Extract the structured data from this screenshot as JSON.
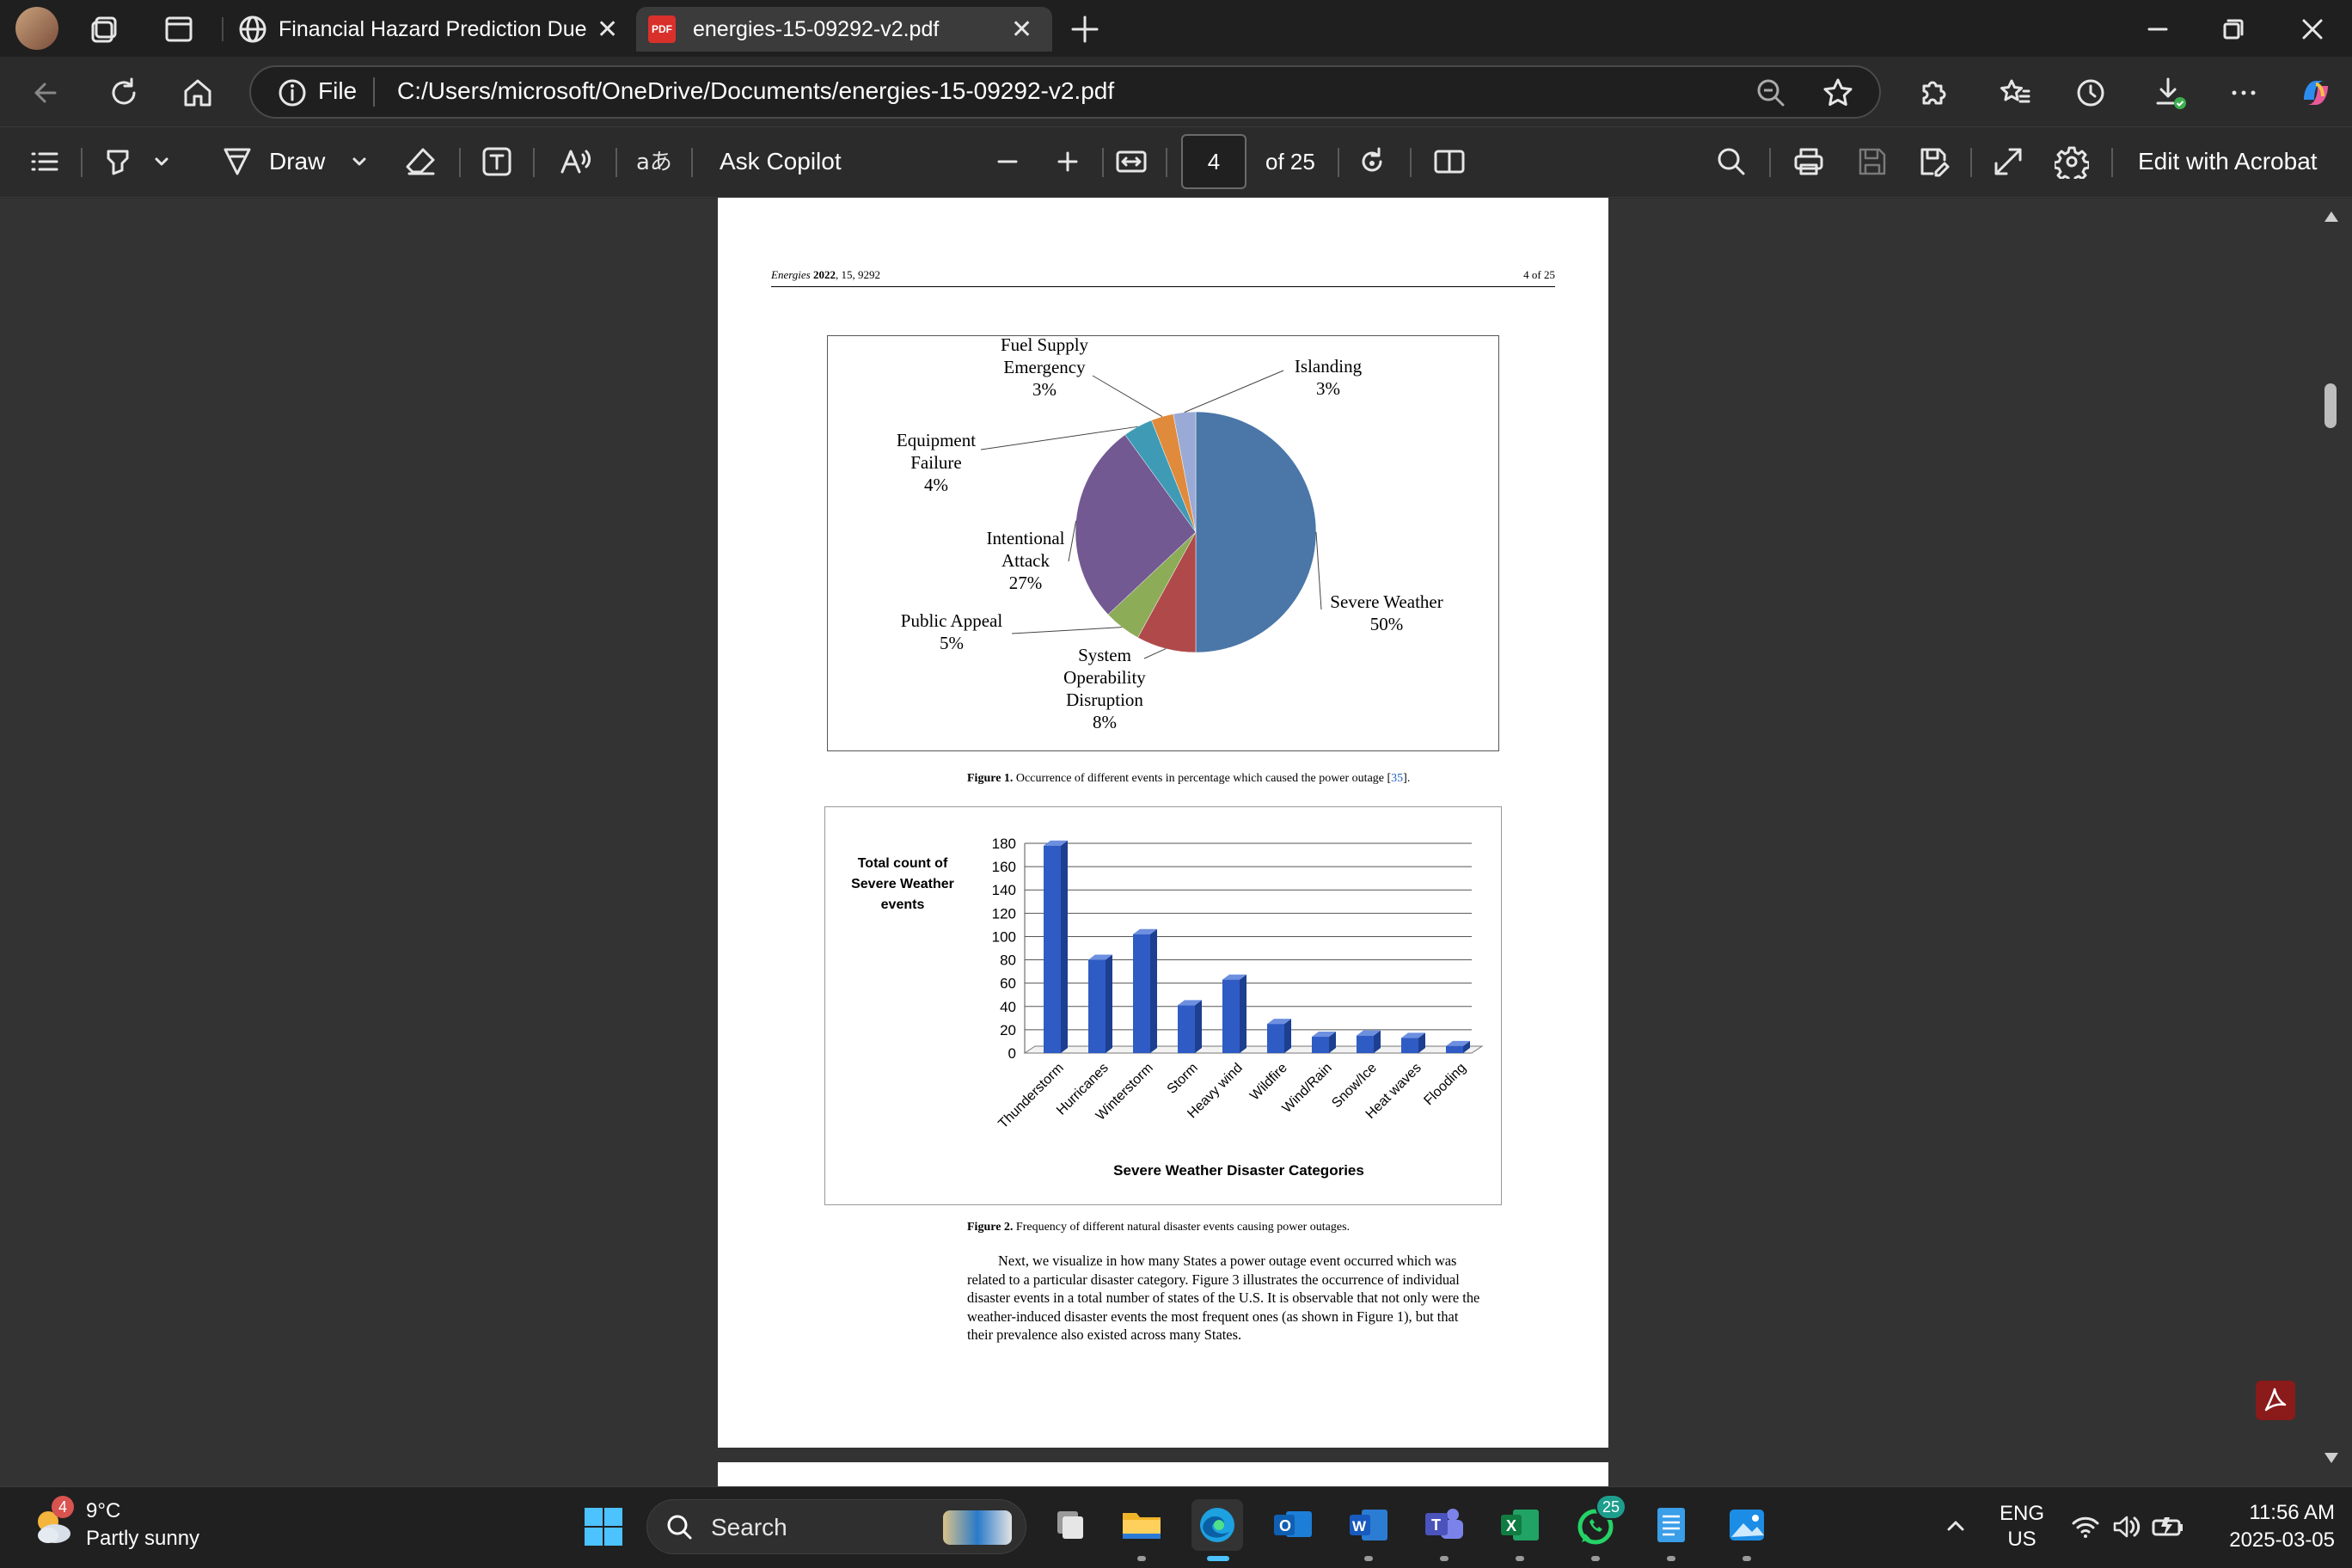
{
  "browser": {
    "tabs": [
      {
        "label": "Financial Hazard Prediction Due t"
      },
      {
        "label": "energies-15-09292-v2.pdf"
      }
    ],
    "address": {
      "scheme": "File",
      "url": "C:/Users/microsoft/OneDrive/Documents/energies-15-09292-v2.pdf"
    }
  },
  "pdf_toolbar": {
    "draw_label": "Draw",
    "ask_copilot": "Ask Copilot",
    "page_current": "4",
    "page_total": "of 25",
    "edit_acrobat": "Edit with Acrobat"
  },
  "page": {
    "header_journal": "Energies",
    "header_year": "2022",
    "header_vol": ", 15, 9292",
    "header_page": "4 of 25",
    "fig1_caption_bold": "Figure 1.",
    "fig1_caption": " Occurrence of different events in percentage which caused the power outage [",
    "fig1_ref": "35",
    "fig1_caption_end": "].",
    "fig2_caption_bold": "Figure 2.",
    "fig2_caption": " Frequency of different natural disaster events causing power outages.",
    "paragraph": [
      "Next, we visualize in how many States a power outage event occurred which was",
      "related to a particular disaster category. Figure 3 illustrates the occurrence of individual",
      "disaster events in a total number of states of the U.S. It is observable that not only were the",
      "weather-induced disaster events the most frequent ones (as shown in Figure 1), but that",
      "their prevalence also existed across many States."
    ]
  },
  "chart_data": [
    {
      "type": "pie",
      "categories": [
        "Severe Weather",
        "System Operability Disruption",
        "Public Appeal",
        "Intentional Attack",
        "Equipment Failure",
        "Fuel Supply Emergency",
        "Islanding"
      ],
      "values": [
        50,
        8,
        5,
        27,
        4,
        3,
        3
      ],
      "labels": [
        [
          "Severe Weather",
          "50%"
        ],
        [
          "System",
          "Operability",
          "Disruption",
          "8%"
        ],
        [
          "Public Appeal",
          "5%"
        ],
        [
          "Intentional",
          "Attack",
          "27%"
        ],
        [
          "Equipment",
          "Failure",
          "4%"
        ],
        [
          "Fuel Supply",
          "Emergency",
          "3%"
        ],
        [
          "Islanding",
          "3%"
        ]
      ],
      "colors": [
        "#4a76a8",
        "#b04a4a",
        "#8cac58",
        "#735992",
        "#3f9bb5",
        "#e08a3c",
        "#9aaad6"
      ]
    },
    {
      "type": "bar",
      "categories": [
        "Thunderstorm",
        "Hurricanes",
        "Winterstorm",
        "Storm",
        "Heavy wind",
        "Wildfire",
        "Wind/Rain",
        "Snow/Ice",
        "Heat waves",
        "Flooding"
      ],
      "values": [
        178,
        80,
        102,
        41,
        63,
        25,
        14,
        15,
        13,
        6
      ],
      "ylabel": "Total count of Severe Weather events",
      "xlabel": "Severe Weather Disaster Categories",
      "ylim": [
        0,
        180
      ],
      "yticks": [
        0,
        20,
        40,
        60,
        80,
        100,
        120,
        140,
        160,
        180
      ],
      "grid": true,
      "color": "#2f5bc4"
    }
  ],
  "taskbar": {
    "weather_temp": "9°C",
    "weather_desc": "Partly sunny",
    "weather_badge": "4",
    "search_placeholder": "Search",
    "whatsapp_badge": "25",
    "lang": "ENG",
    "region": "US",
    "time": "11:56 AM",
    "date": "2025-03-05"
  }
}
